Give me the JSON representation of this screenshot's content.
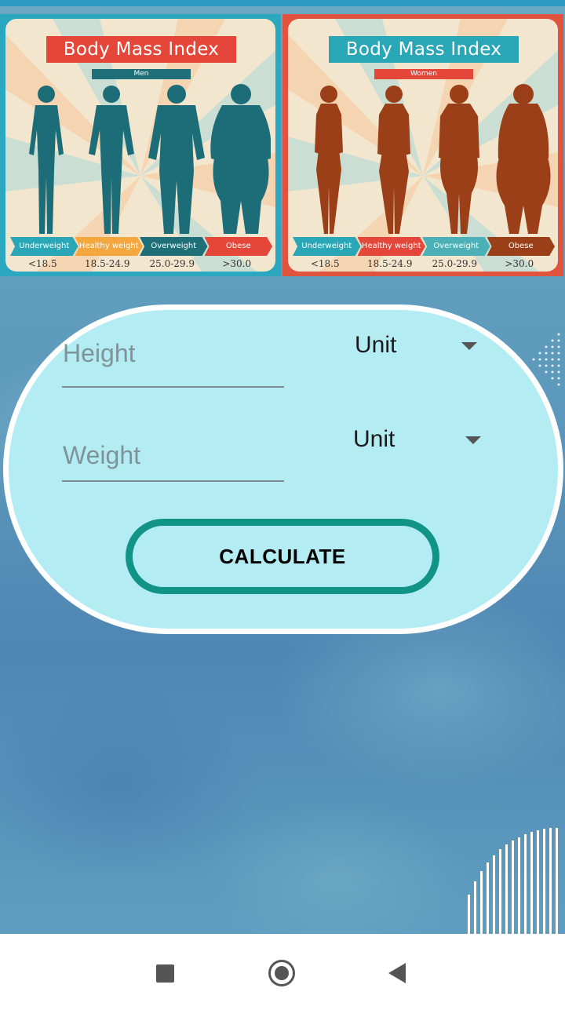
{
  "posters": {
    "men": {
      "title": "Body Mass Index",
      "subtitle": "Men",
      "figure_color": "#1d6d78",
      "categories": [
        {
          "label": "Underweight",
          "color": "#2aa7b6"
        },
        {
          "label": "Healthy weight",
          "color": "#f4a73e"
        },
        {
          "label": "Overweight",
          "color": "#1f6f78"
        },
        {
          "label": "Obese",
          "color": "#e4473a"
        }
      ],
      "ranges": [
        "<18.5",
        "18.5-24.9",
        "25.0-29.9",
        ">30.0"
      ]
    },
    "women": {
      "title": "Body Mass Index",
      "subtitle": "Women",
      "figure_color": "#9a3f17",
      "categories": [
        {
          "label": "Underweight",
          "color": "#2aa7b6"
        },
        {
          "label": "Healthy weight",
          "color": "#e4473a"
        },
        {
          "label": "Overweight",
          "color": "#4bb1b6"
        },
        {
          "label": "Obese",
          "color": "#9a3f17"
        }
      ],
      "ranges": [
        "<18.5",
        "18.5-24.9",
        "25.0-29.9",
        ">30.0"
      ]
    }
  },
  "form": {
    "height_placeholder": "Height",
    "weight_placeholder": "Weight",
    "height_unit": "Unit",
    "weight_unit": "Unit",
    "calculate_label": "CALCULATE"
  },
  "colors": {
    "card_bg": "#b3ecf3",
    "button_border": "#119485"
  },
  "nav": {
    "recent_icon": "square-icon",
    "home_icon": "circle-icon",
    "back_icon": "triangle-back-icon"
  }
}
